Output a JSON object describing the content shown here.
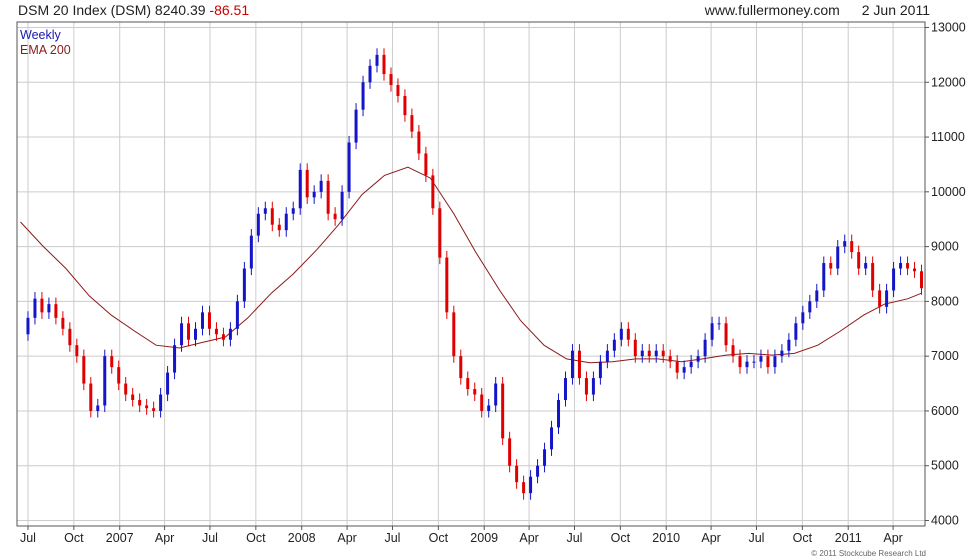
{
  "header": {
    "title": "DSM 20 Index (DSM) 8240.39",
    "change": "-86.51",
    "site": "www.fullermoney.com",
    "date": "2 Jun 2011"
  },
  "legend": {
    "weekly": "Weekly",
    "ema": "EMA 200"
  },
  "copyright": "© 2011 Stockcube Research Ltd",
  "colors": {
    "up": "#1414c8",
    "down": "#e00000",
    "ema": "#8b1a1a",
    "grid": "#cccccc"
  },
  "chart_data": {
    "type": "candlestick",
    "frequency": "weekly",
    "grid": true,
    "y_axis_position": "right",
    "legend_position": "top-left",
    "ylim": [
      3900,
      13100
    ],
    "y_ticks": [
      4000,
      5000,
      6000,
      7000,
      8000,
      9000,
      10000,
      11000,
      12000,
      13000
    ],
    "x_ticks": [
      {
        "label": "Jul",
        "date": "2006-07-01"
      },
      {
        "label": "Oct",
        "date": "2006-10-01"
      },
      {
        "label": "2007",
        "date": "2007-01-01"
      },
      {
        "label": "Apr",
        "date": "2007-04-01"
      },
      {
        "label": "Jul",
        "date": "2007-07-01"
      },
      {
        "label": "Oct",
        "date": "2007-10-01"
      },
      {
        "label": "2008",
        "date": "2008-01-01"
      },
      {
        "label": "Apr",
        "date": "2008-04-01"
      },
      {
        "label": "Jul",
        "date": "2008-07-01"
      },
      {
        "label": "Oct",
        "date": "2008-10-01"
      },
      {
        "label": "2009",
        "date": "2009-01-01"
      },
      {
        "label": "Apr",
        "date": "2009-04-01"
      },
      {
        "label": "Jul",
        "date": "2009-07-01"
      },
      {
        "label": "Oct",
        "date": "2009-10-01"
      },
      {
        "label": "2010",
        "date": "2010-01-01"
      },
      {
        "label": "Apr",
        "date": "2010-04-01"
      },
      {
        "label": "Jul",
        "date": "2010-07-01"
      },
      {
        "label": "Oct",
        "date": "2010-10-01"
      },
      {
        "label": "2011",
        "date": "2011-01-01"
      },
      {
        "label": "Apr",
        "date": "2011-04-01"
      }
    ],
    "price_series": {
      "name": "Weekly",
      "points": [
        [
          "2006-06-16",
          7400
        ],
        [
          "2006-07-01",
          7700
        ],
        [
          "2006-07-15",
          8050
        ],
        [
          "2006-07-29",
          7800
        ],
        [
          "2006-08-12",
          7950
        ],
        [
          "2006-08-26",
          7700
        ],
        [
          "2006-09-09",
          7500
        ],
        [
          "2006-09-23",
          7200
        ],
        [
          "2006-10-07",
          7000
        ],
        [
          "2006-10-21",
          6500
        ],
        [
          "2006-11-04",
          6000
        ],
        [
          "2006-11-18",
          6100
        ],
        [
          "2006-12-02",
          7000
        ],
        [
          "2006-12-16",
          6800
        ],
        [
          "2006-12-30",
          6500
        ],
        [
          "2007-01-13",
          6300
        ],
        [
          "2007-01-27",
          6200
        ],
        [
          "2007-02-10",
          6100
        ],
        [
          "2007-02-24",
          6050
        ],
        [
          "2007-03-10",
          6000
        ],
        [
          "2007-03-24",
          6300
        ],
        [
          "2007-04-07",
          6700
        ],
        [
          "2007-04-21",
          7200
        ],
        [
          "2007-05-05",
          7600
        ],
        [
          "2007-05-19",
          7300
        ],
        [
          "2007-06-02",
          7500
        ],
        [
          "2007-06-16",
          7800
        ],
        [
          "2007-06-30",
          7500
        ],
        [
          "2007-07-14",
          7400
        ],
        [
          "2007-07-28",
          7300
        ],
        [
          "2007-08-11",
          7500
        ],
        [
          "2007-08-25",
          8000
        ],
        [
          "2007-09-08",
          8600
        ],
        [
          "2007-09-22",
          9200
        ],
        [
          "2007-10-06",
          9600
        ],
        [
          "2007-10-20",
          9700
        ],
        [
          "2007-11-03",
          9400
        ],
        [
          "2007-11-17",
          9300
        ],
        [
          "2007-12-01",
          9600
        ],
        [
          "2007-12-15",
          9700
        ],
        [
          "2007-12-29",
          10400
        ],
        [
          "2008-01-12",
          9900
        ],
        [
          "2008-01-26",
          10000
        ],
        [
          "2008-02-09",
          10200
        ],
        [
          "2008-02-23",
          9600
        ],
        [
          "2008-03-08",
          9500
        ],
        [
          "2008-03-22",
          10000
        ],
        [
          "2008-04-05",
          10900
        ],
        [
          "2008-04-19",
          11500
        ],
        [
          "2008-05-03",
          12000
        ],
        [
          "2008-05-17",
          12300
        ],
        [
          "2008-05-31",
          12500
        ],
        [
          "2008-06-14",
          12150
        ],
        [
          "2008-06-28",
          11950
        ],
        [
          "2008-07-12",
          11750
        ],
        [
          "2008-07-26",
          11400
        ],
        [
          "2008-08-09",
          11100
        ],
        [
          "2008-08-23",
          10700
        ],
        [
          "2008-09-06",
          10300
        ],
        [
          "2008-09-20",
          9700
        ],
        [
          "2008-10-04",
          8800
        ],
        [
          "2008-10-18",
          7800
        ],
        [
          "2008-11-01",
          7000
        ],
        [
          "2008-11-15",
          6600
        ],
        [
          "2008-11-29",
          6400
        ],
        [
          "2008-12-13",
          6300
        ],
        [
          "2008-12-27",
          6000
        ],
        [
          "2009-01-10",
          6100
        ],
        [
          "2009-01-24",
          6500
        ],
        [
          "2009-02-07",
          5500
        ],
        [
          "2009-02-21",
          5000
        ],
        [
          "2009-03-07",
          4700
        ],
        [
          "2009-03-21",
          4500
        ],
        [
          "2009-04-04",
          4800
        ],
        [
          "2009-04-18",
          5000
        ],
        [
          "2009-05-02",
          5300
        ],
        [
          "2009-05-16",
          5700
        ],
        [
          "2009-05-30",
          6200
        ],
        [
          "2009-06-13",
          6600
        ],
        [
          "2009-06-27",
          7100
        ],
        [
          "2009-07-11",
          6600
        ],
        [
          "2009-07-25",
          6300
        ],
        [
          "2009-08-08",
          6600
        ],
        [
          "2009-08-22",
          6900
        ],
        [
          "2009-09-05",
          7100
        ],
        [
          "2009-09-19",
          7300
        ],
        [
          "2009-10-03",
          7500
        ],
        [
          "2009-10-17",
          7300
        ],
        [
          "2009-10-31",
          7000
        ],
        [
          "2009-11-14",
          7100
        ],
        [
          "2009-11-28",
          7000
        ],
        [
          "2009-12-12",
          7100
        ],
        [
          "2009-12-26",
          7000
        ],
        [
          "2010-01-09",
          6900
        ],
        [
          "2010-01-23",
          6700
        ],
        [
          "2010-02-06",
          6800
        ],
        [
          "2010-02-20",
          6900
        ],
        [
          "2010-03-06",
          7000
        ],
        [
          "2010-03-20",
          7300
        ],
        [
          "2010-04-03",
          7600
        ],
        [
          "2010-04-17",
          7600
        ],
        [
          "2010-05-01",
          7200
        ],
        [
          "2010-05-15",
          7000
        ],
        [
          "2010-05-29",
          6800
        ],
        [
          "2010-06-12",
          6900
        ],
        [
          "2010-06-26",
          6900
        ],
        [
          "2010-07-10",
          7000
        ],
        [
          "2010-07-24",
          6800
        ],
        [
          "2010-08-07",
          7000
        ],
        [
          "2010-08-21",
          7100
        ],
        [
          "2010-09-04",
          7300
        ],
        [
          "2010-09-18",
          7600
        ],
        [
          "2010-10-02",
          7800
        ],
        [
          "2010-10-16",
          8000
        ],
        [
          "2010-10-30",
          8200
        ],
        [
          "2010-11-13",
          8700
        ],
        [
          "2010-11-27",
          8600
        ],
        [
          "2010-12-11",
          9000
        ],
        [
          "2010-12-25",
          9100
        ],
        [
          "2011-01-08",
          8900
        ],
        [
          "2011-01-22",
          8600
        ],
        [
          "2011-02-05",
          8700
        ],
        [
          "2011-02-19",
          8200
        ],
        [
          "2011-03-05",
          7900
        ],
        [
          "2011-03-19",
          8200
        ],
        [
          "2011-04-02",
          8600
        ],
        [
          "2011-04-16",
          8700
        ],
        [
          "2011-04-30",
          8600
        ],
        [
          "2011-05-14",
          8550
        ],
        [
          "2011-05-28",
          8240
        ]
      ]
    },
    "ema_series": {
      "name": "EMA 200",
      "points": [
        [
          "2006-06-16",
          9450
        ],
        [
          "2006-08-01",
          9000
        ],
        [
          "2006-09-15",
          8600
        ],
        [
          "2006-11-01",
          8100
        ],
        [
          "2006-12-15",
          7750
        ],
        [
          "2007-02-01",
          7450
        ],
        [
          "2007-03-15",
          7200
        ],
        [
          "2007-05-01",
          7150
        ],
        [
          "2007-06-15",
          7250
        ],
        [
          "2007-08-01",
          7350
        ],
        [
          "2007-09-15",
          7700
        ],
        [
          "2007-11-01",
          8150
        ],
        [
          "2007-12-15",
          8500
        ],
        [
          "2008-02-01",
          8950
        ],
        [
          "2008-03-15",
          9400
        ],
        [
          "2008-05-01",
          9950
        ],
        [
          "2008-06-15",
          10300
        ],
        [
          "2008-08-01",
          10450
        ],
        [
          "2008-09-15",
          10250
        ],
        [
          "2008-11-01",
          9600
        ],
        [
          "2008-12-15",
          8900
        ],
        [
          "2009-02-01",
          8200
        ],
        [
          "2009-03-15",
          7650
        ],
        [
          "2009-05-01",
          7200
        ],
        [
          "2009-06-15",
          6950
        ],
        [
          "2009-08-01",
          6880
        ],
        [
          "2009-09-15",
          6900
        ],
        [
          "2009-11-01",
          6950
        ],
        [
          "2009-12-15",
          6950
        ],
        [
          "2010-02-01",
          6900
        ],
        [
          "2010-03-15",
          6950
        ],
        [
          "2010-05-01",
          7020
        ],
        [
          "2010-06-15",
          7050
        ],
        [
          "2010-08-01",
          7020
        ],
        [
          "2010-09-15",
          7050
        ],
        [
          "2010-11-01",
          7200
        ],
        [
          "2010-12-15",
          7450
        ],
        [
          "2011-02-01",
          7750
        ],
        [
          "2011-03-15",
          7950
        ],
        [
          "2011-05-01",
          8050
        ],
        [
          "2011-05-28",
          8150
        ]
      ]
    }
  }
}
